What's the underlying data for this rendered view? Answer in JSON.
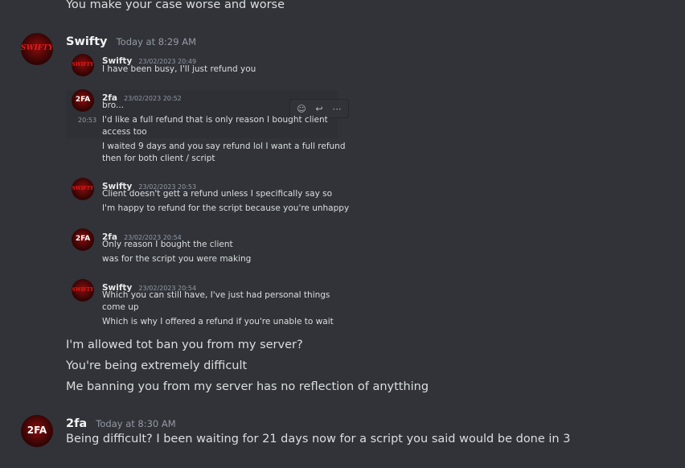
{
  "messages": [
    {
      "text": "You make your case worse and worse"
    }
  ],
  "groups": [
    {
      "author": "Swifty",
      "avatar_text": "SWIFTY",
      "timestamp": "Today at 8:29 AM",
      "quote": [
        {
          "author": "Swifty",
          "avatar_text": "SWIFTY",
          "timestamp": "23/02/2023 20:49",
          "lines": [
            "I have been busy, I'll just refund you"
          ]
        },
        {
          "author": "2fa",
          "avatar_text": "2FA",
          "timestamp": "23/02/2023 20:52",
          "lines": [
            "bro...",
            "I'd like a full refund that is only reason I bought client",
            "access too",
            "I waited 9 days and you say refund lol I want a full refund",
            "then for both client / script"
          ],
          "inline_time": "20:53"
        },
        {
          "author": "Swifty",
          "avatar_text": "SWIFTY",
          "timestamp": "23/02/2023 20:53",
          "lines": [
            "Client doesn't gett a refund unless I specifically say so",
            "I'm happy to refund for the script because you're unhappy"
          ]
        },
        {
          "author": "2fa",
          "avatar_text": "2FA",
          "timestamp": "23/02/2023 20:54",
          "lines": [
            "Only reason I bought the client",
            "was for the script you were making"
          ]
        },
        {
          "author": "Swifty",
          "avatar_text": "SWIFTY",
          "timestamp": "23/02/2023 20:54",
          "lines": [
            "Which you can still have, I've just had personal things",
            "come up",
            "Which is why I offered a refund if you're unable to wait"
          ]
        }
      ],
      "lines": [
        "I'm allowed tot ban you from my server?",
        "You're being extremely difficult",
        "Me banning you from my server has no reflection of anytthing"
      ]
    },
    {
      "author": "2fa",
      "avatar_text": "2FA",
      "timestamp": "Today at 8:30 AM",
      "lines": [
        "Being difficult? I been waiting  for 21 days now for a script you said would be done in 3"
      ]
    }
  ],
  "toolbar": {
    "icons": [
      "add-reaction-icon",
      "reply-icon",
      "more-icon"
    ],
    "glyphs": [
      "☺",
      "↩",
      "⋯"
    ]
  }
}
